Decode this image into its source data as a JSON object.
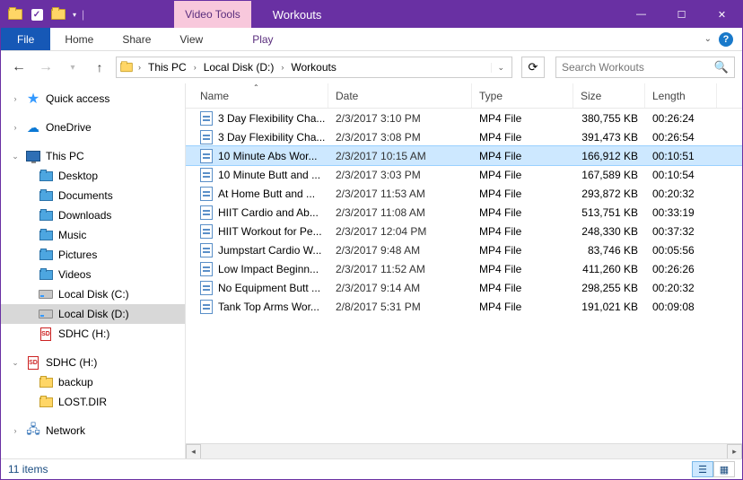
{
  "titlebar": {
    "context_tool": "Video Tools",
    "title": "Workouts"
  },
  "ribbon": {
    "file": "File",
    "tabs": [
      "Home",
      "Share",
      "View"
    ],
    "context_tab": "Play"
  },
  "breadcrumb": {
    "parts": [
      "This PC",
      "Local Disk (D:)",
      "Workouts"
    ]
  },
  "search": {
    "placeholder": "Search Workouts"
  },
  "sidebar": {
    "quick_access": "Quick access",
    "onedrive": "OneDrive",
    "this_pc": "This PC",
    "desktop": "Desktop",
    "documents": "Documents",
    "downloads": "Downloads",
    "music": "Music",
    "pictures": "Pictures",
    "videos": "Videos",
    "local_c": "Local Disk (C:)",
    "local_d": "Local Disk (D:)",
    "sdhc1": "SDHC (H:)",
    "sdhc2": "SDHC (H:)",
    "backup": "backup",
    "lostdir": "LOST.DIR",
    "network": "Network"
  },
  "columns": {
    "name": "Name",
    "date": "Date",
    "type": "Type",
    "size": "Size",
    "length": "Length"
  },
  "files": [
    {
      "name": "3 Day Flexibility Cha...",
      "date": "2/3/2017 3:10 PM",
      "type": "MP4 File",
      "size": "380,755 KB",
      "length": "00:26:24"
    },
    {
      "name": "3 Day Flexibility Cha...",
      "date": "2/3/2017 3:08 PM",
      "type": "MP4 File",
      "size": "391,473 KB",
      "length": "00:26:54"
    },
    {
      "name": "10 Minute Abs Wor...",
      "date": "2/3/2017 10:15 AM",
      "type": "MP4 File",
      "size": "166,912 KB",
      "length": "00:10:51",
      "selected": true
    },
    {
      "name": "10 Minute Butt and ...",
      "date": "2/3/2017 3:03 PM",
      "type": "MP4 File",
      "size": "167,589 KB",
      "length": "00:10:54"
    },
    {
      "name": "At Home Butt and ...",
      "date": "2/3/2017 11:53 AM",
      "type": "MP4 File",
      "size": "293,872 KB",
      "length": "00:20:32"
    },
    {
      "name": "HIIT Cardio and Ab...",
      "date": "2/3/2017 11:08 AM",
      "type": "MP4 File",
      "size": "513,751 KB",
      "length": "00:33:19"
    },
    {
      "name": "HIIT Workout for Pe...",
      "date": "2/3/2017 12:04 PM",
      "type": "MP4 File",
      "size": "248,330 KB",
      "length": "00:37:32"
    },
    {
      "name": "Jumpstart Cardio W...",
      "date": "2/3/2017 9:48 AM",
      "type": "MP4 File",
      "size": "83,746 KB",
      "length": "00:05:56"
    },
    {
      "name": "Low Impact Beginn...",
      "date": "2/3/2017 11:52 AM",
      "type": "MP4 File",
      "size": "411,260 KB",
      "length": "00:26:26"
    },
    {
      "name": "No Equipment Butt ...",
      "date": "2/3/2017 9:14 AM",
      "type": "MP4 File",
      "size": "298,255 KB",
      "length": "00:20:32"
    },
    {
      "name": "Tank Top Arms Wor...",
      "date": "2/8/2017 5:31 PM",
      "type": "MP4 File",
      "size": "191,021 KB",
      "length": "00:09:08"
    }
  ],
  "statusbar": {
    "count": "11 items"
  }
}
